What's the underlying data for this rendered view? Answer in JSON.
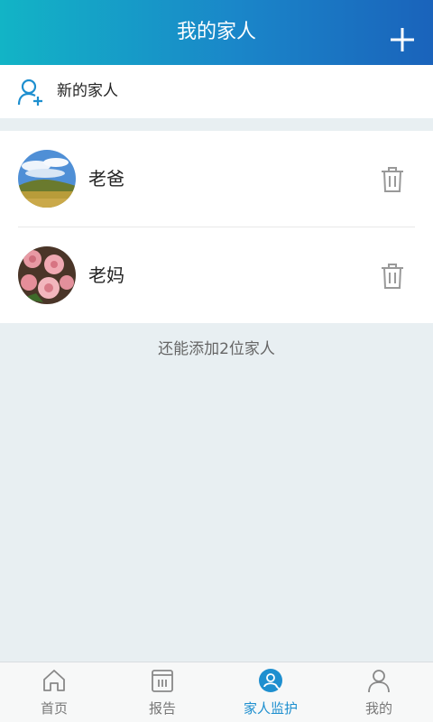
{
  "header": {
    "title": "我的家人"
  },
  "new_family": {
    "label": "新的家人"
  },
  "members": [
    {
      "name": "老爸"
    },
    {
      "name": "老妈"
    }
  ],
  "hint": "还能添加2位家人",
  "tabs": [
    {
      "label": "首页",
      "icon": "home-icon",
      "active": false
    },
    {
      "label": "报告",
      "icon": "report-icon",
      "active": false
    },
    {
      "label": "家人监护",
      "icon": "family-monitor-icon",
      "active": true
    },
    {
      "label": "我的",
      "icon": "profile-icon",
      "active": false
    }
  ],
  "colors": {
    "header_start": "#12b4c6",
    "header_end": "#1a63bb",
    "accent": "#1e8fcf",
    "background": "#e8eff2"
  }
}
